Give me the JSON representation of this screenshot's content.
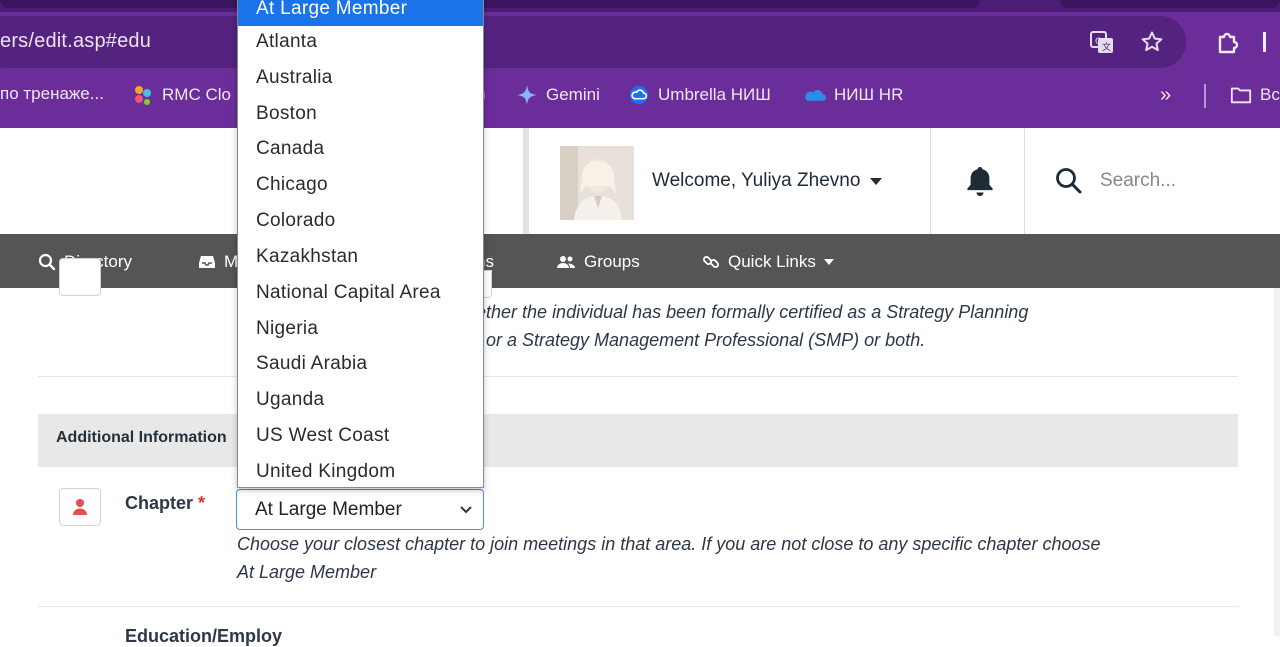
{
  "browser": {
    "url": "ers/edit.asp#edu",
    "bookmarks": [
      {
        "label": "по тренаже...",
        "icon": "bookmark-icon"
      },
      {
        "label": "RMC Clo",
        "icon": "rmc-dots-icon"
      },
      {
        "label": "n",
        "icon": "none"
      },
      {
        "label": "Gemini",
        "icon": "gemini-sparkle-icon"
      },
      {
        "label": "Umbrella НИШ",
        "icon": "cloud-outline-icon"
      },
      {
        "label": "НИШ HR",
        "icon": "onedrive-cloud-icon"
      },
      {
        "label": "Bc",
        "icon": "folder-icon"
      }
    ],
    "more_label": "»"
  },
  "header": {
    "welcome": "Welcome, Yuliya Zhevno",
    "search_placeholder": "Search..."
  },
  "nav": {
    "items": [
      {
        "label": "Directory",
        "icon": "search-icon"
      },
      {
        "label": "M",
        "icon": "inbox-icon"
      },
      {
        "label": "ns",
        "icon": "none"
      },
      {
        "label": "Groups",
        "icon": "groups-icon"
      },
      {
        "label": "Quick Links",
        "icon": "link-icon"
      }
    ]
  },
  "content": {
    "certification_desc_line1": "hether the individual has been formally certified as a Strategy Planning",
    "certification_desc_line2": "or a Strategy Management Professional (SMP) or both.",
    "section_title": "Additional Information",
    "chapter": {
      "label": "Chapter",
      "required_mark": "*",
      "selected": "At Large Member",
      "help_line1": "Choose your closest chapter to join meetings in that area. If you are not close to any specific chapter choose",
      "help_line2": "At Large Member"
    },
    "next_field_label": "Education/Employ"
  },
  "dropdown": {
    "options": [
      "At Large Member",
      "Atlanta",
      "Australia",
      "Boston",
      "Canada",
      "Chicago",
      "Colorado",
      "Kazakhstan",
      "National Capital Area",
      "Nigeria",
      "Saudi Arabia",
      "Uganda",
      "US West Coast",
      "United Kingdom"
    ],
    "highlighted_index": 0
  },
  "colors": {
    "chrome": "#6b2d99",
    "navbar": "#555555",
    "highlight": "#1a73e8",
    "required": "#d9342b"
  }
}
